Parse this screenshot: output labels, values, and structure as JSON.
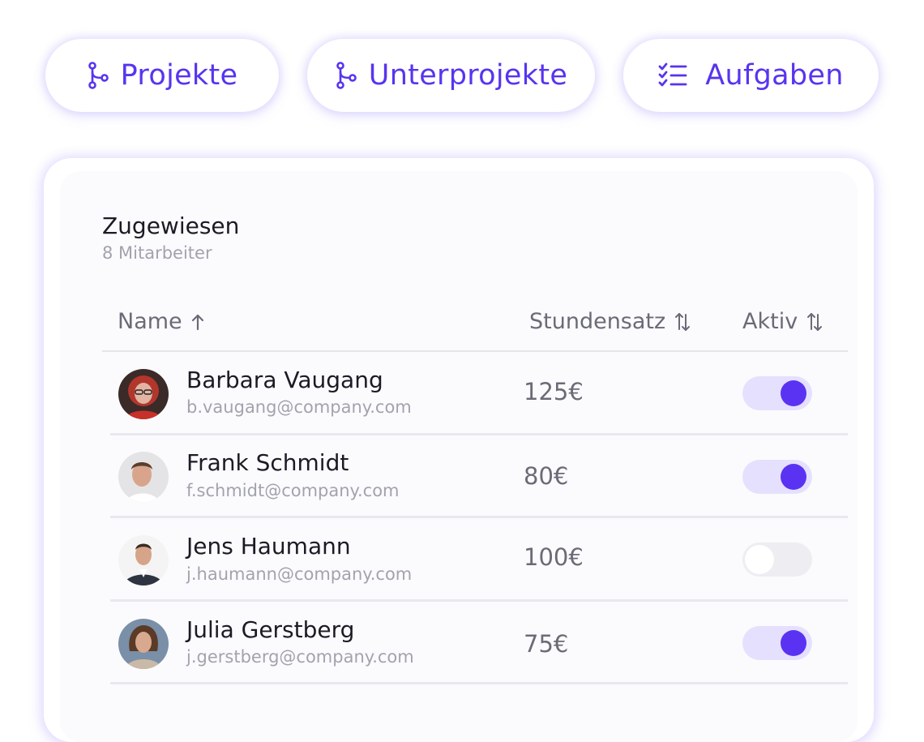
{
  "nav": {
    "tabs": [
      {
        "label": "Projekte",
        "icon": "branch-icon"
      },
      {
        "label": "Unterprojekte",
        "icon": "branch-icon"
      },
      {
        "label": "Aufgaben",
        "icon": "checklist-icon"
      }
    ]
  },
  "card": {
    "title": "Zugewiesen",
    "subtitle": "8 Mitarbeiter",
    "columns": {
      "name": "Name",
      "rate": "Stundensatz",
      "active": "Aktiv"
    },
    "rows": [
      {
        "name": "Barbara Vaugang",
        "email": "b.vaugang@company.com",
        "rate": "125€",
        "active": true
      },
      {
        "name": "Frank Schmidt",
        "email": "f.schmidt@company.com",
        "rate": "80€",
        "active": true
      },
      {
        "name": "Jens Haumann",
        "email": "j.haumann@company.com",
        "rate": "100€",
        "active": false
      },
      {
        "name": "Julia Gerstberg",
        "email": "j.gerstberg@company.com",
        "rate": "75€",
        "active": true
      }
    ]
  },
  "colors": {
    "accent": "#5834f0",
    "toggle_on_track": "#e6e0ff",
    "toggle_off_track": "#ededf2"
  }
}
